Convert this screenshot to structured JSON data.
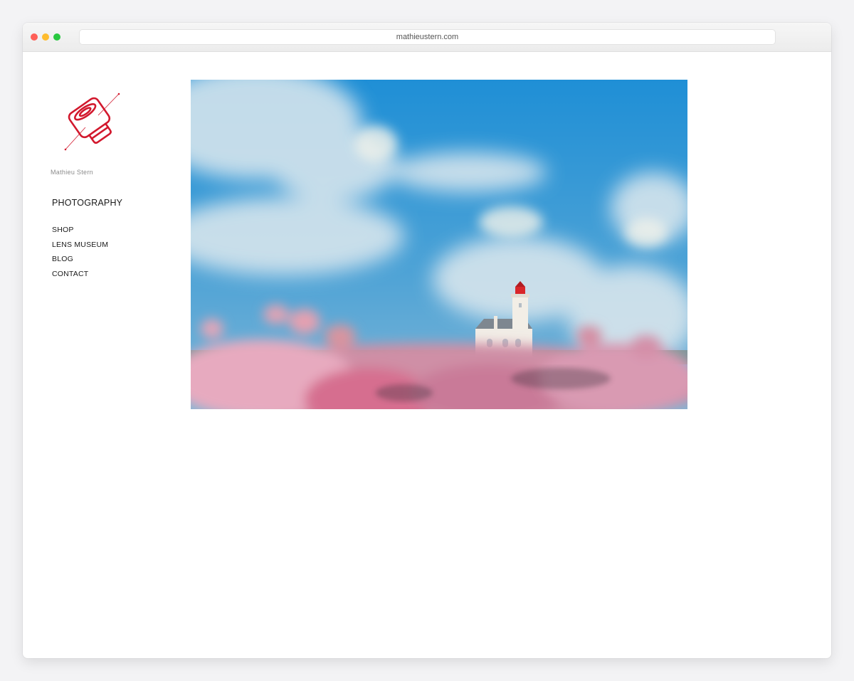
{
  "browser": {
    "url": "mathieustern.com"
  },
  "site": {
    "name": "Mathieu Stern",
    "logo_color": "#d2182d"
  },
  "nav": {
    "primary": "PHOTOGRAPHY",
    "items": [
      {
        "label": "SHOP"
      },
      {
        "label": "LENS MUSEUM"
      },
      {
        "label": "BLOG"
      },
      {
        "label": "CONTACT"
      }
    ]
  },
  "hero": {
    "image": "lighthouse-behind-pink-flowers-photo"
  }
}
